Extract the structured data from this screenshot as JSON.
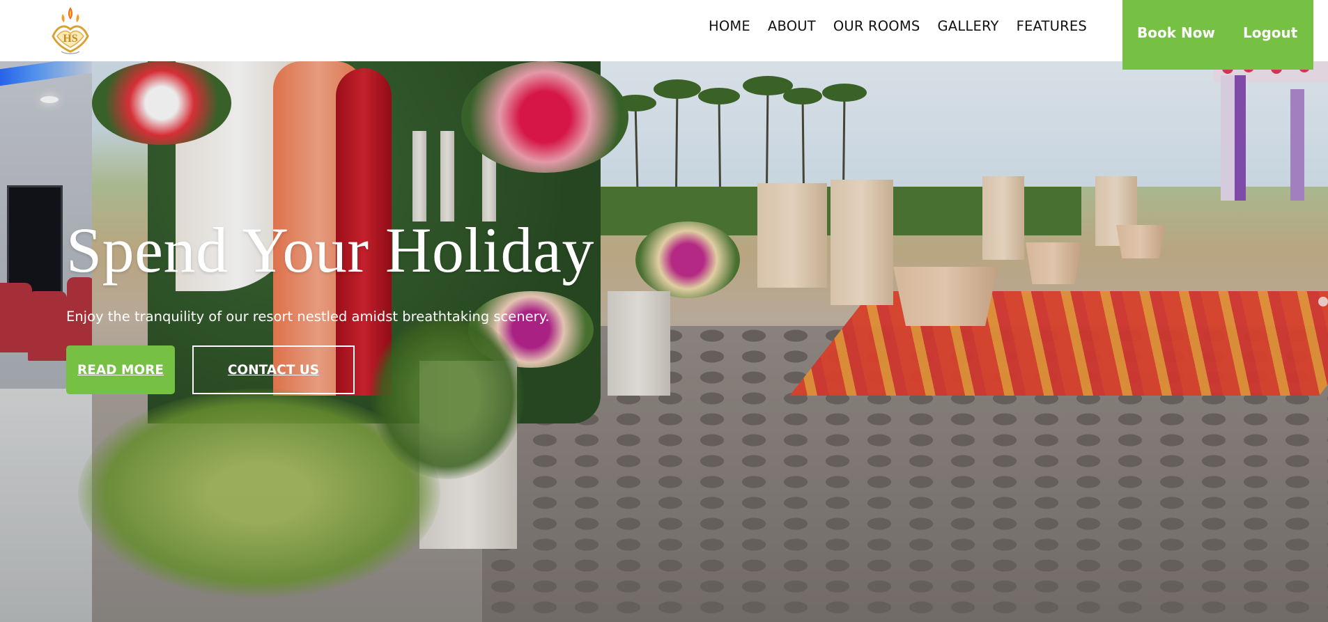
{
  "brand": {
    "logo_text": "HS",
    "logo_icon": "hs-crest-logo"
  },
  "nav": {
    "items": [
      {
        "label": "HOME"
      },
      {
        "label": "ABOUT"
      },
      {
        "label": "OUR ROOMS"
      },
      {
        "label": "GALLERY"
      },
      {
        "label": "FEATURES"
      }
    ],
    "book_now": "Book Now",
    "logout": "Logout"
  },
  "hero": {
    "title": "Spend Your Holiday",
    "subtitle": "Enjoy the tranquility of our resort nestled amidst breathtaking scenery.",
    "read_more": "READ MORE",
    "contact_us": "CONTACT US"
  },
  "colors": {
    "accent": "#76c043",
    "header_bg": "#ffffff",
    "text_light": "#ffffff"
  }
}
